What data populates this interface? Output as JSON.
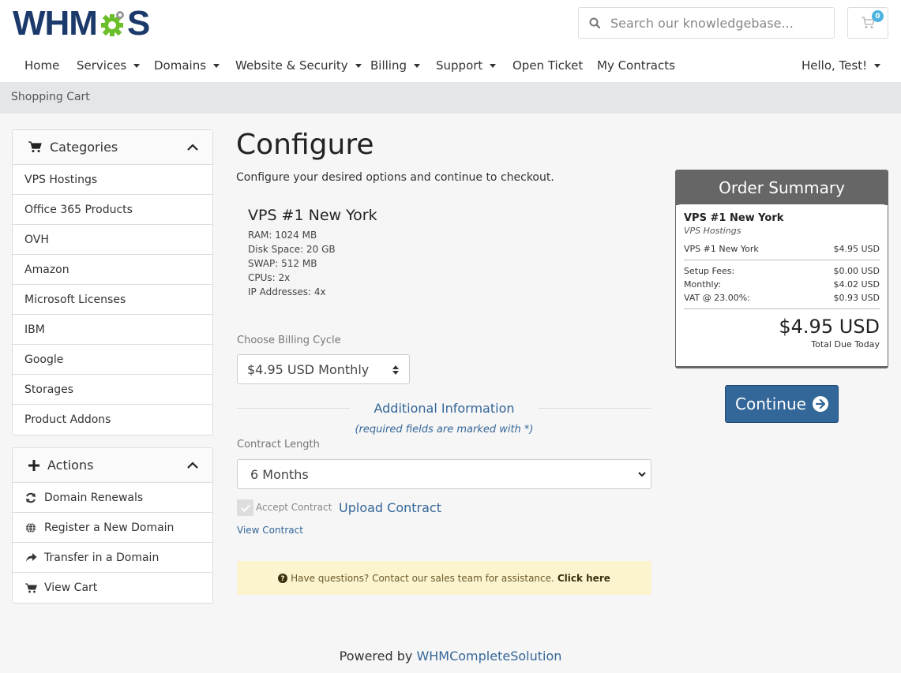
{
  "header": {
    "logo_left": "WHM",
    "logo_right": "S",
    "search_placeholder": "Search our knowledgebase...",
    "cart_count": "0"
  },
  "nav": {
    "items": [
      {
        "label": "Home"
      },
      {
        "label": "Services"
      },
      {
        "label": "Domains"
      },
      {
        "label": "Website & Security"
      },
      {
        "label": "Billing"
      },
      {
        "label": "Support"
      },
      {
        "label": "Open Ticket"
      },
      {
        "label": "My Contracts"
      }
    ],
    "user": "Hello, Test!"
  },
  "breadcrumb": "Shopping Cart",
  "categories": {
    "title": "Categories",
    "items": [
      "VPS Hostings",
      "Office 365 Products",
      "OVH",
      "Amazon",
      "Microsoft Licenses",
      "IBM",
      "Google",
      "Storages",
      "Product Addons"
    ]
  },
  "actions": {
    "title": "Actions",
    "items": [
      {
        "label": "Domain Renewals",
        "icon": "refresh-icon"
      },
      {
        "label": "Register a New Domain",
        "icon": "globe-icon"
      },
      {
        "label": "Transfer in a Domain",
        "icon": "share-icon"
      },
      {
        "label": "View Cart",
        "icon": "cart-icon"
      }
    ]
  },
  "main": {
    "title": "Configure",
    "description": "Configure your desired options and continue to checkout.",
    "product": {
      "name": "VPS #1 New York",
      "specs": [
        "RAM: 1024 MB",
        "Disk Space: 20 GB",
        "SWAP: 512 MB",
        "CPUs: 2x",
        "IP Addresses: 4x"
      ]
    },
    "billing_label": "Choose Billing Cycle",
    "billing_value": "$4.95 USD Monthly",
    "additional_title": "Additional Information",
    "additional_note": "(required fields are marked with *)",
    "contract_label": "Contract Length",
    "contract_value": "6 Months",
    "accept_label": "Accept Contract",
    "upload_label": "Upload Contract",
    "view_label": "View Contract",
    "help_text": "Have questions? Contact our sales team for assistance.",
    "help_link": "Click here"
  },
  "summary": {
    "title": "Order Summary",
    "product_name": "VPS #1 New York",
    "product_category": "VPS Hostings",
    "line_label": "VPS #1 New York",
    "line_value": "$4.95 USD",
    "rows": [
      {
        "label": "Setup Fees:",
        "value": "$0.00 USD"
      },
      {
        "label": "Monthly:",
        "value": "$4.02 USD"
      },
      {
        "label": "VAT @ 23.00%:",
        "value": "$0.93 USD"
      }
    ],
    "total": "$4.95 USD",
    "total_label": "Total Due Today",
    "continue_label": "Continue"
  },
  "footer": {
    "prefix": "Powered by",
    "link": "WHMCompleteSolution"
  },
  "colors": {
    "brand_dark": "#1b3a6b",
    "brand_green": "#6cbf2a",
    "accent": "#336699",
    "summary_head": "#666666",
    "help_bg": "#fcf3cf"
  }
}
